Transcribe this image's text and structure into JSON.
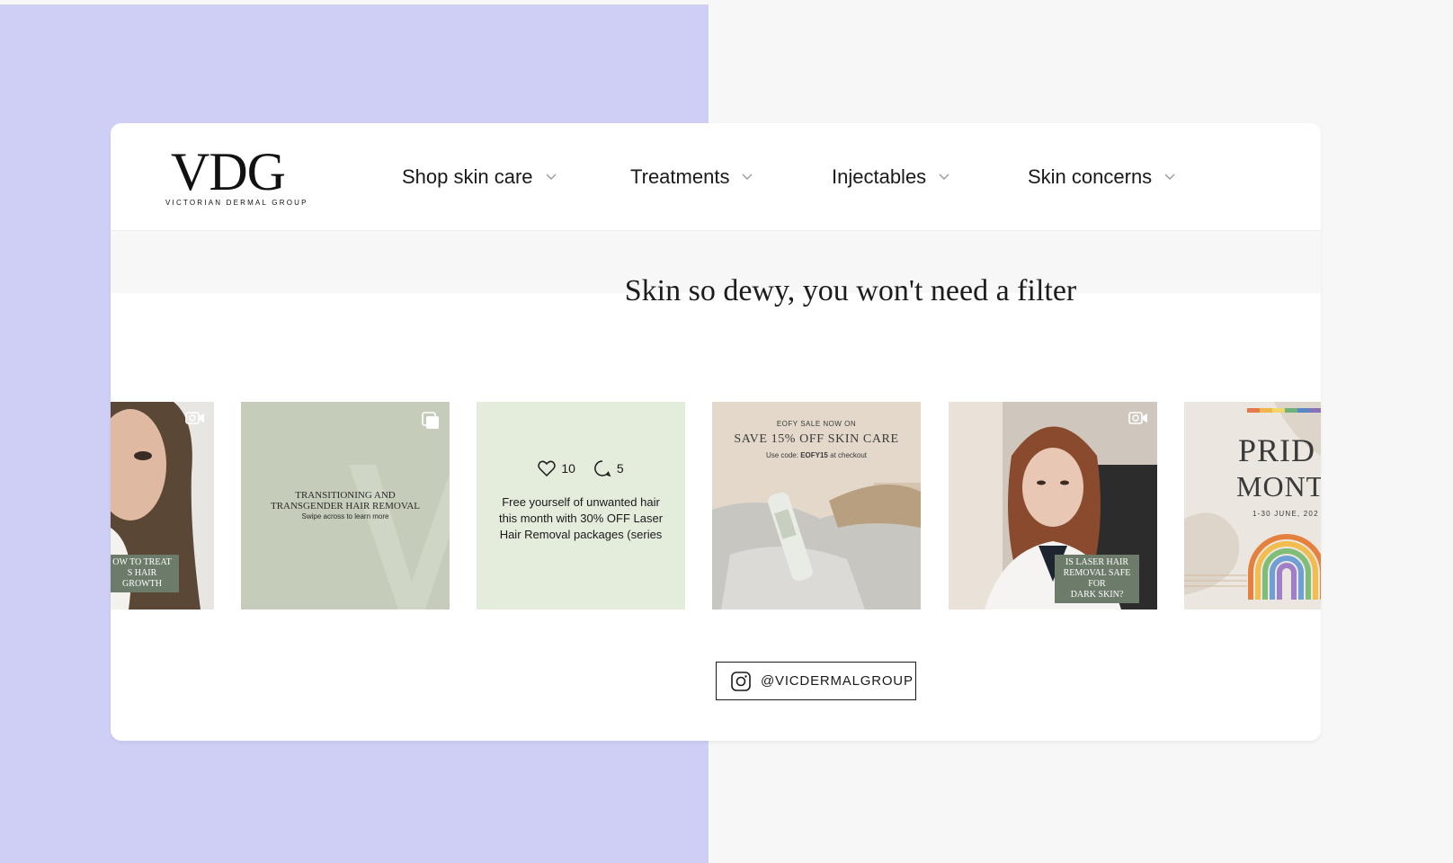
{
  "logo": {
    "mark": "VDG",
    "subtitle": "VICTORIAN DERMAL GROUP"
  },
  "nav": [
    {
      "label": "Shop skin care"
    },
    {
      "label": "Treatments"
    },
    {
      "label": "Injectables"
    },
    {
      "label": "Skin concerns"
    }
  ],
  "feed": {
    "title": "Skin so dewy, you won't need a filter",
    "tiles": [
      {
        "type": "video",
        "tag_line1": "OW TO TREAT",
        "tag_line2": "S HAIR GROWTH"
      },
      {
        "type": "carousel",
        "headline_line1": "TRANSITIONING AND",
        "headline_line2": "TRANSGENDER HAIR REMOVAL",
        "sub": "Swipe across to learn more"
      },
      {
        "type": "hover",
        "likes": "10",
        "comments": "5",
        "caption": "Free yourself of unwanted hair this month with 30% OFF Laser Hair Removal packages (series"
      },
      {
        "type": "image",
        "top": "EOFY SALE NOW ON",
        "headline": "SAVE 15% OFF SKIN CARE",
        "code_prefix": "Use code: ",
        "code": "EOFY15",
        "code_suffix": " at checkout"
      },
      {
        "type": "video",
        "tag_line1": "IS LASER HAIR",
        "tag_line2": "REMOVAL SAFE FOR",
        "tag_line3": "DARK SKIN?"
      },
      {
        "type": "image",
        "line1": "PRID",
        "line2": "MONT",
        "date": "1-30 JUNE, 202"
      }
    ],
    "instagram_handle": "@VICDERMALGROUP"
  },
  "colors": {
    "left_panel": "#cfcff5",
    "page_bg": "#f7f7f7",
    "sage": "#c5ccb9",
    "mint": "#e4ecdb",
    "tag": "#6d7c6a"
  }
}
